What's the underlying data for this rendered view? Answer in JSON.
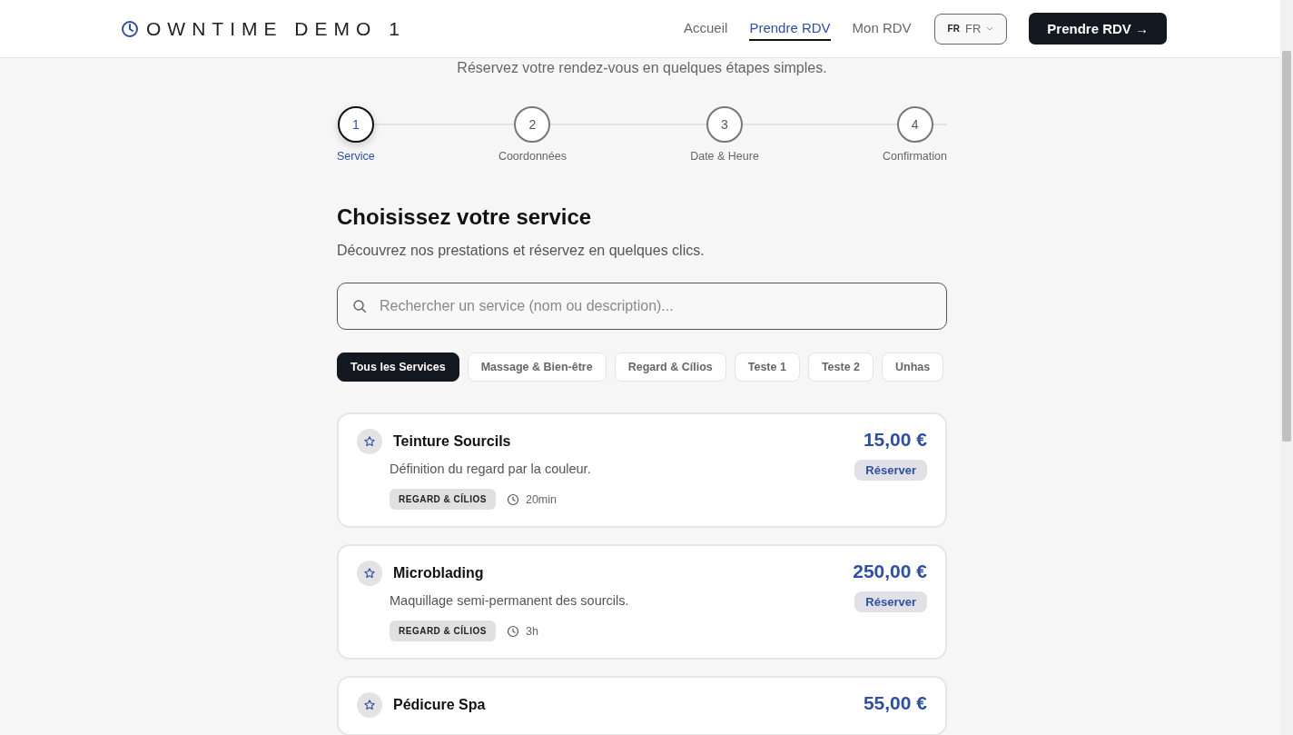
{
  "header": {
    "logo": "OWNTIME DEMO 1",
    "nav": [
      {
        "label": "Accueil",
        "selected": false
      },
      {
        "label": "Prendre RDV",
        "selected": true
      },
      {
        "label": "Mon RDV",
        "selected": false
      }
    ],
    "language": {
      "code": "FR",
      "value": "FR"
    },
    "cta": "Prendre RDV →"
  },
  "subtitle": "Réservez votre rendez-vous en quelques étapes simples.",
  "steps": [
    {
      "number": "1",
      "label": "Service",
      "selected": true
    },
    {
      "number": "2",
      "label": "Coordonnées",
      "selected": false
    },
    {
      "number": "3",
      "label": "Date & Heure",
      "selected": false
    },
    {
      "number": "4",
      "label": "Confirmation",
      "selected": false
    }
  ],
  "section": {
    "title": "Choisissez votre service",
    "description": "Découvrez nos prestations et réservez en quelques clics."
  },
  "search": {
    "placeholder": "Rechercher un service (nom ou description)..."
  },
  "categories": [
    {
      "label": "Tous les Services",
      "selected": true
    },
    {
      "label": "Massage & Bien-être",
      "selected": false
    },
    {
      "label": "Regard & Cílios",
      "selected": false
    },
    {
      "label": "Teste 1",
      "selected": false
    },
    {
      "label": "Teste 2",
      "selected": false
    },
    {
      "label": "Unhas",
      "selected": false
    }
  ],
  "services": [
    {
      "name": "Teinture Sourcils",
      "description": "Définition du regard par la couleur.",
      "category": "REGARD & CÍLIOS",
      "duration": "20min",
      "price": "15,00 €",
      "action": "Réserver"
    },
    {
      "name": "Microblading",
      "description": "Maquillage semi-permanent des sourcils.",
      "category": "REGARD & CÍLIOS",
      "duration": "3h",
      "price": "250,00 €",
      "action": "Réserver"
    },
    {
      "name": "Pédicure Spa",
      "price": "55,00 €"
    }
  ]
}
